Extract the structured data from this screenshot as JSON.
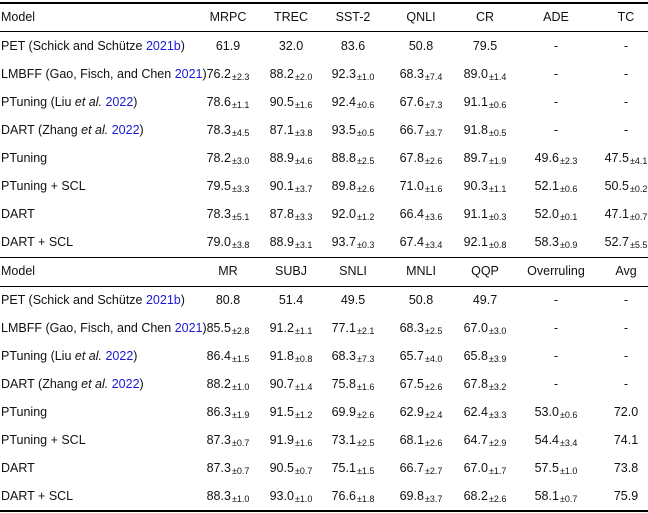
{
  "sections": [
    {
      "header": [
        "Model",
        "MRPC",
        "TREC",
        "SST-2",
        "QNLI",
        "CR",
        "ADE",
        "TC"
      ],
      "rows": [
        {
          "pre": "PET (Schick and Schütze ",
          "mid": "",
          "cite": "2021b",
          "post": ")",
          "cells": [
            [
              "61.9",
              ""
            ],
            [
              "32.0",
              ""
            ],
            [
              "83.6",
              ""
            ],
            [
              "50.8",
              ""
            ],
            [
              "79.5",
              ""
            ],
            [
              "-",
              ""
            ],
            [
              "-",
              ""
            ]
          ]
        },
        {
          "pre": "LMBFF (Gao, Fisch, and Chen ",
          "mid": "",
          "cite": "2021",
          "post": ")",
          "cells": [
            [
              "76.2",
              "±2.3"
            ],
            [
              "88.2",
              "±2.0"
            ],
            [
              "92.3",
              "±1.0"
            ],
            [
              "68.3",
              "±7.4"
            ],
            [
              "89.0",
              "±1.4"
            ],
            [
              "-",
              ""
            ],
            [
              "-",
              ""
            ]
          ]
        },
        {
          "pre": "PTuning (Liu ",
          "mid": "et al.",
          "cite": "2022",
          "post": ")",
          "cells": [
            [
              "78.6",
              "±1.1"
            ],
            [
              "90.5",
              "±1.6"
            ],
            [
              "92.4",
              "±0.6"
            ],
            [
              "67.6",
              "±7.3"
            ],
            [
              "91.1",
              "±0.6"
            ],
            [
              "-",
              ""
            ],
            [
              "-",
              ""
            ]
          ]
        },
        {
          "pre": "DART (Zhang ",
          "mid": "et al.",
          "cite": "2022",
          "post": ")",
          "cells": [
            [
              "78.3",
              "±4.5"
            ],
            [
              "87.1",
              "±3.8"
            ],
            [
              "93.5",
              "±0.5"
            ],
            [
              "66.7",
              "±3.7"
            ],
            [
              "91.8",
              "±0.5"
            ],
            [
              "-",
              ""
            ],
            [
              "-",
              ""
            ]
          ]
        },
        {
          "pre": "PTuning",
          "mid": "",
          "cite": "",
          "post": "",
          "cells": [
            [
              "78.2",
              "±3.0"
            ],
            [
              "88.9",
              "±4.6"
            ],
            [
              "88.8",
              "±2.5"
            ],
            [
              "67.8",
              "±2.6"
            ],
            [
              "89.7",
              "±1.9"
            ],
            [
              "49.6",
              "±2.3"
            ],
            [
              "47.5",
              "±4.1"
            ]
          ]
        },
        {
          "pre": "PTuning + SCL",
          "mid": "",
          "cite": "",
          "post": "",
          "cells": [
            [
              "79.5",
              "±3.3"
            ],
            [
              "90.1",
              "±3.7"
            ],
            [
              "89.8",
              "±2.6"
            ],
            [
              "71.0",
              "±1.6"
            ],
            [
              "90.3",
              "±1.1"
            ],
            [
              "52.1",
              "±0.6"
            ],
            [
              "50.5",
              "±0.2"
            ]
          ]
        },
        {
          "pre": "DART",
          "mid": "",
          "cite": "",
          "post": "",
          "cells": [
            [
              "78.3",
              "±5.1"
            ],
            [
              "87.8",
              "±3.3"
            ],
            [
              "92.0",
              "±1.2"
            ],
            [
              "66.4",
              "±3.6"
            ],
            [
              "91.1",
              "±0.3"
            ],
            [
              "52.0",
              "±0.1"
            ],
            [
              "47.1",
              "±0.7"
            ]
          ]
        },
        {
          "pre": "DART + SCL",
          "mid": "",
          "cite": "",
          "post": "",
          "cells": [
            [
              "79.0",
              "±3.8"
            ],
            [
              "88.9",
              "±3.1"
            ],
            [
              "93.7",
              "±0.3"
            ],
            [
              "67.4",
              "±3.4"
            ],
            [
              "92.1",
              "±0.8"
            ],
            [
              "58.3",
              "±0.9"
            ],
            [
              "52.7",
              "±5.5"
            ]
          ]
        }
      ]
    },
    {
      "header": [
        "Model",
        "MR",
        "SUBJ",
        "SNLI",
        "MNLI",
        "QQP",
        "Overruling",
        "Avg"
      ],
      "rows": [
        {
          "pre": "PET (Schick and Schütze ",
          "mid": "",
          "cite": "2021b",
          "post": ")",
          "cells": [
            [
              "80.8",
              ""
            ],
            [
              "51.4",
              ""
            ],
            [
              "49.5",
              ""
            ],
            [
              "50.8",
              ""
            ],
            [
              "49.7",
              ""
            ],
            [
              "-",
              ""
            ],
            [
              "-",
              ""
            ]
          ]
        },
        {
          "pre": "LMBFF (Gao, Fisch, and Chen ",
          "mid": "",
          "cite": "2021",
          "post": ")",
          "cells": [
            [
              "85.5",
              "±2.8"
            ],
            [
              "91.2",
              "±1.1"
            ],
            [
              "77.1",
              "±2.1"
            ],
            [
              "68.3",
              "±2.5"
            ],
            [
              "67.0",
              "±3.0"
            ],
            [
              "-",
              ""
            ],
            [
              "-",
              ""
            ]
          ]
        },
        {
          "pre": "PTuning (Liu ",
          "mid": "et al.",
          "cite": "2022",
          "post": ")",
          "cells": [
            [
              "86.4",
              "±1.5"
            ],
            [
              "91.8",
              "±0.8"
            ],
            [
              "68.3",
              "±7.3"
            ],
            [
              "65.7",
              "±4.0"
            ],
            [
              "65.8",
              "±3.9"
            ],
            [
              "-",
              ""
            ],
            [
              "-",
              ""
            ]
          ]
        },
        {
          "pre": "DART (Zhang ",
          "mid": "et al.",
          "cite": "2022",
          "post": ")",
          "cells": [
            [
              "88.2",
              "±1.0"
            ],
            [
              "90.7",
              "±1.4"
            ],
            [
              "75.8",
              "±1.6"
            ],
            [
              "67.5",
              "±2.6"
            ],
            [
              "67.8",
              "±3.2"
            ],
            [
              "-",
              ""
            ],
            [
              "-",
              ""
            ]
          ]
        },
        {
          "pre": "PTuning",
          "mid": "",
          "cite": "",
          "post": "",
          "cells": [
            [
              "86.3",
              "±1.9"
            ],
            [
              "91.5",
              "±1.2"
            ],
            [
              "69.9",
              "±2.6"
            ],
            [
              "62.9",
              "±2.4"
            ],
            [
              "62.4",
              "±3.3"
            ],
            [
              "53.0",
              "±0.6"
            ],
            [
              "72.0",
              ""
            ]
          ]
        },
        {
          "pre": "PTuning + SCL",
          "mid": "",
          "cite": "",
          "post": "",
          "cells": [
            [
              "87.3",
              "±0.7"
            ],
            [
              "91.9",
              "±1.6"
            ],
            [
              "73.1",
              "±2.5"
            ],
            [
              "68.1",
              "±2.6"
            ],
            [
              "64.7",
              "±2.9"
            ],
            [
              "54.4",
              "±3.4"
            ],
            [
              "74.1",
              ""
            ]
          ]
        },
        {
          "pre": "DART",
          "mid": "",
          "cite": "",
          "post": "",
          "cells": [
            [
              "87.3",
              "±0.7"
            ],
            [
              "90.5",
              "±0.7"
            ],
            [
              "75.1",
              "±1.5"
            ],
            [
              "66.7",
              "±2.7"
            ],
            [
              "67.0",
              "±1.7"
            ],
            [
              "57.5",
              "±1.0"
            ],
            [
              "73.8",
              ""
            ]
          ]
        },
        {
          "pre": "DART + SCL",
          "mid": "",
          "cite": "",
          "post": "",
          "cells": [
            [
              "88.3",
              "±1.0"
            ],
            [
              "93.0",
              "±1.0"
            ],
            [
              "76.6",
              "±1.8"
            ],
            [
              "69.8",
              "±3.7"
            ],
            [
              "68.2",
              "±2.6"
            ],
            [
              "58.1",
              "±0.7"
            ],
            [
              "75.9",
              ""
            ]
          ]
        }
      ]
    }
  ]
}
